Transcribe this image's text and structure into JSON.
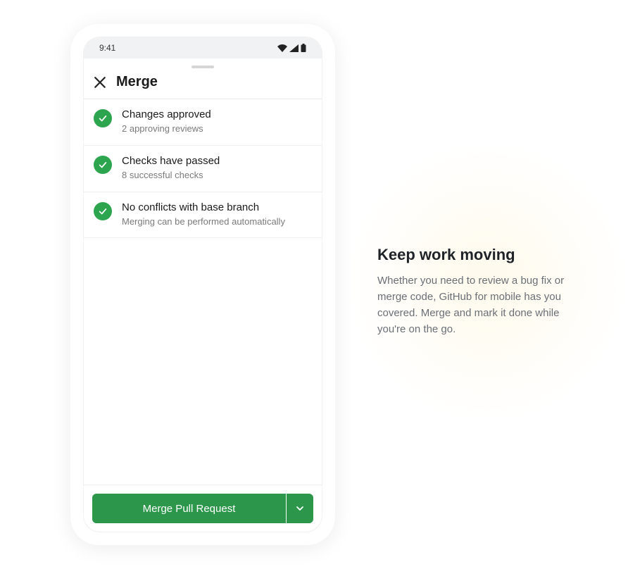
{
  "statusbar": {
    "time": "9:41"
  },
  "sheet": {
    "title": "Merge"
  },
  "statuses": [
    {
      "title": "Changes approved",
      "subtitle": "2 approving reviews"
    },
    {
      "title": "Checks have passed",
      "subtitle": "8 successful checks"
    },
    {
      "title": "No conflicts with base branch",
      "subtitle": "Merging can be performed automatically"
    }
  ],
  "footer": {
    "merge_label": "Merge Pull Request"
  },
  "promo": {
    "title": "Keep work moving",
    "body": "Whether you need to review a bug fix or merge code, GitHub for mobile has you covered. Merge and mark it done while you're on the go."
  },
  "colors": {
    "success": "#2da44e",
    "button": "#2c974b"
  }
}
